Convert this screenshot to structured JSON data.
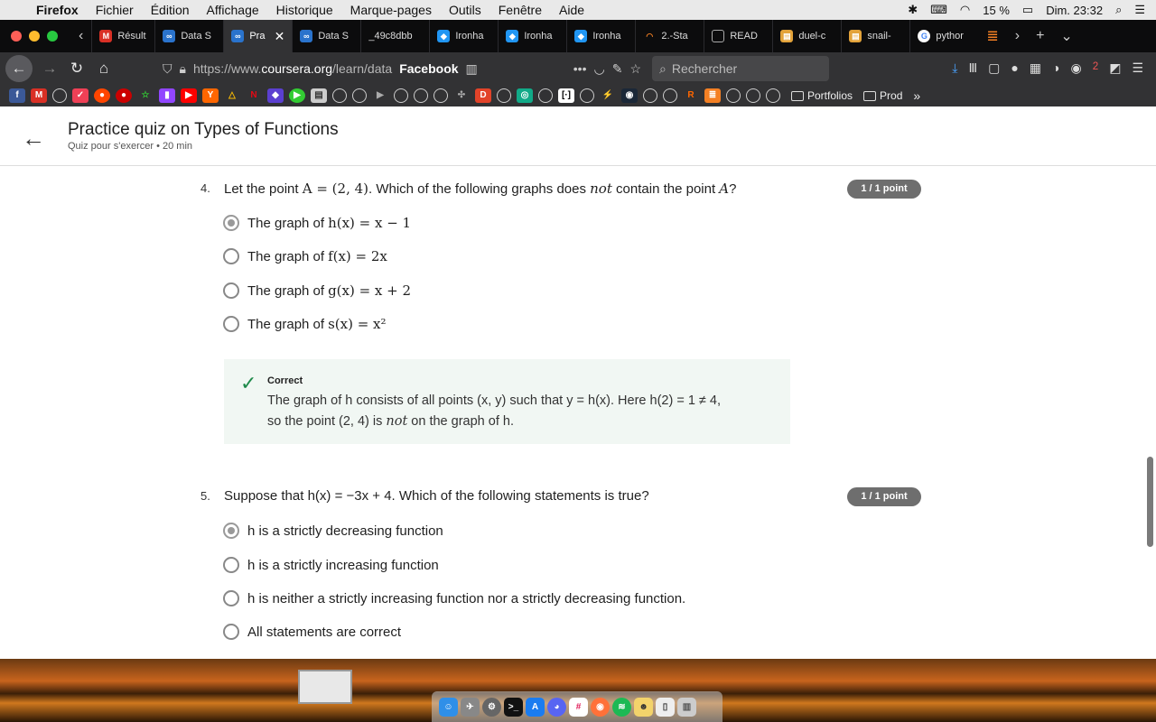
{
  "menubar": {
    "app": "Firefox",
    "items": [
      "Fichier",
      "Édition",
      "Affichage",
      "Historique",
      "Marque-pages",
      "Outils",
      "Fenêtre",
      "Aide"
    ],
    "battery": "15 %",
    "clock": "Dim. 23:32"
  },
  "tabs": [
    {
      "label": "Résult",
      "color": "#d93025"
    },
    {
      "label": "Data S",
      "color": "#2a73cc"
    },
    {
      "label": "Pra",
      "color": "#2a73cc",
      "active": true
    },
    {
      "label": "Data S",
      "color": "#2a73cc"
    },
    {
      "label": "_49c8dbb",
      "color": "#0c0c0d"
    },
    {
      "label": "Ironha",
      "color": "#2196f3"
    },
    {
      "label": "Ironha",
      "color": "#2196f3"
    },
    {
      "label": "Ironha",
      "color": "#2196f3"
    },
    {
      "label": "2.-Sta",
      "color": "#f48024"
    },
    {
      "label": "READ",
      "color": "#555"
    },
    {
      "label": "duel-c",
      "color": "#e3a33a"
    },
    {
      "label": "snail-",
      "color": "#e3a33a"
    },
    {
      "label": "pythor",
      "color": "#4285f4"
    }
  ],
  "navbar": {
    "url_prefix": "https://www.",
    "url_domain": "coursera.org",
    "url_path": "/learn/data",
    "page_title": "Facebook",
    "search_placeholder": "Rechercher",
    "badge_count": "2"
  },
  "bookmarks": {
    "folders": [
      "Portfolios",
      "Prod"
    ],
    "icons": [
      "facebook-icon",
      "gmail-icon",
      "globe-icon",
      "pocket-icon",
      "reddit-icon",
      "record-icon",
      "star-icon",
      "twitch-icon",
      "youtube-icon",
      "ycombinator-icon",
      "drive-icon",
      "netflix-icon",
      "app-icon",
      "play-icon",
      "app-icon",
      "globe-icon",
      "globe-icon",
      "play-icon",
      "globe-icon",
      "globe-icon",
      "globe-icon",
      "puzzle-icon",
      "globe-icon",
      "d-icon",
      "globe-icon",
      "bracket-icon",
      "globe-icon",
      "code-icon",
      "globe-icon",
      "steam-icon",
      "globe-icon",
      "globe-icon",
      "r-icon",
      "stack-icon",
      "globe-icon",
      "globe-icon",
      "globe-icon"
    ]
  },
  "header": {
    "title": "Practice quiz on Types of Functions",
    "subtitle": "Quiz pour s'exercer • 20  min"
  },
  "q4": {
    "number": "4.",
    "text_a": "Let the point ",
    "text_math1": "A = (2, 4)",
    "text_b": ". Which of the following graphs does ",
    "text_not": "not",
    "text_c": " contain the point ",
    "text_math2": "A",
    "text_d": "?",
    "badge": "1 / 1 point",
    "options": [
      {
        "prefix": "The graph of ",
        "math": "h(x) = x − 1",
        "selected": true
      },
      {
        "prefix": "The graph of ",
        "math": "f(x) = 2x",
        "selected": false
      },
      {
        "prefix": "The graph of ",
        "math": "g(x) = x + 2",
        "selected": false
      },
      {
        "prefix": "The graph of ",
        "math": "s(x) = x²",
        "selected": false
      }
    ],
    "feedback": {
      "label": "Correct",
      "line1": "The graph of h consists of all points (x, y) such that y = h(x). Here h(2) = 1 ≠ 4,",
      "line2_a": "so the point (2, 4) is ",
      "line2_not": "not",
      "line2_b": " on the graph of h."
    }
  },
  "q5": {
    "number": "5.",
    "text": "Suppose that h(x) = −3x + 4. Which of the following statements is true?",
    "badge": "1 / 1 point",
    "options": [
      {
        "label": "h is a strictly decreasing function",
        "selected": true
      },
      {
        "label": "h is a strictly increasing function",
        "selected": false
      },
      {
        "label": "h is neither a strictly increasing function nor a strictly decreasing function.",
        "selected": false
      },
      {
        "label": "All statements are correct",
        "selected": false
      }
    ]
  },
  "dock": {
    "icons": [
      "finder-icon",
      "launchpad-icon",
      "system-preferences-icon",
      "terminal-icon",
      "app-store-icon",
      "discord-icon",
      "slack-icon",
      "firefox-icon",
      "spotify-icon",
      "preview-icon",
      "document-icon",
      "trash-icon"
    ]
  }
}
